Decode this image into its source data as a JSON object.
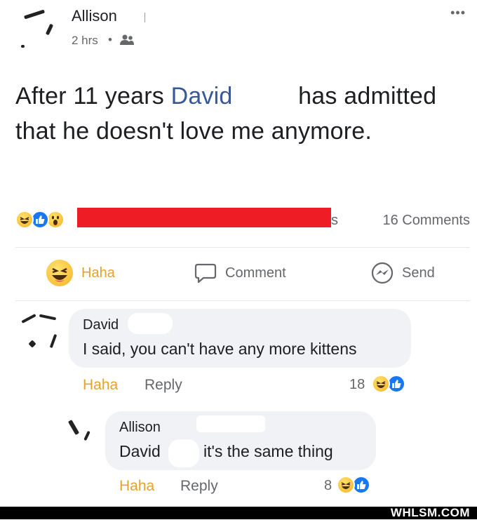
{
  "post": {
    "author": "Allison",
    "time": "2 hrs",
    "separator": "•",
    "more": "•••",
    "text_before": "After 11 years ",
    "mention": "David",
    "text_after": " has admitted that he doesn't love me anymore.",
    "reaction_summary_tail": "s",
    "comments_count": "16 Comments"
  },
  "actions": {
    "haha": "Haha",
    "comment": "Comment",
    "send": "Send"
  },
  "comments": [
    {
      "author": "David",
      "text": "I said, you can't have any more kittens",
      "haha": "Haha",
      "reply": "Reply",
      "count": "18"
    }
  ],
  "reply": {
    "author": "Allison",
    "mention": "David",
    "text": "it's the same thing",
    "haha": "Haha",
    "reply": "Reply",
    "count": "8"
  },
  "watermark": "WHLSM.COM",
  "colors": {
    "mention": "#385898",
    "haha": "#e5a22b",
    "redaction": "#ee1c25"
  }
}
